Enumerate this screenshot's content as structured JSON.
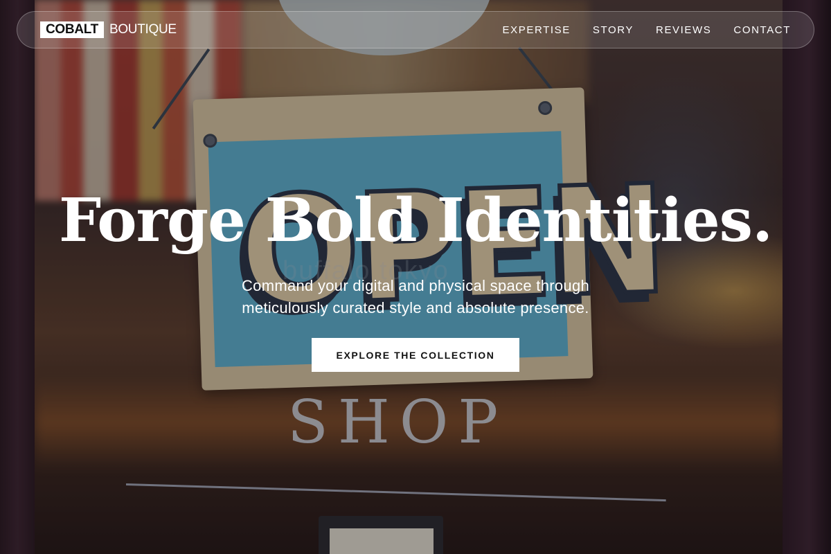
{
  "brand": {
    "name_boxed": "COBALT",
    "name_rest": "BOUTIQUE"
  },
  "nav": {
    "items": [
      {
        "label": "EXPERTISE"
      },
      {
        "label": "STORY"
      },
      {
        "label": "REVIEWS"
      },
      {
        "label": "CONTACT"
      }
    ]
  },
  "hero": {
    "title": "Forge Bold Identities.",
    "subtitle": "Command your digital and physical space through meticulously curated style and absolute presence.",
    "cta_label": "EXPLORE THE COLLECTION"
  },
  "background": {
    "sign_text": "OPEN",
    "sign_watermark": "buffalo tokyo",
    "glass_text": "SHOP"
  },
  "colors": {
    "cta_background": "#ffffff",
    "cta_text": "#111111",
    "sign_blue": "#5aa9c7",
    "sign_cream": "#cdbd9c"
  }
}
